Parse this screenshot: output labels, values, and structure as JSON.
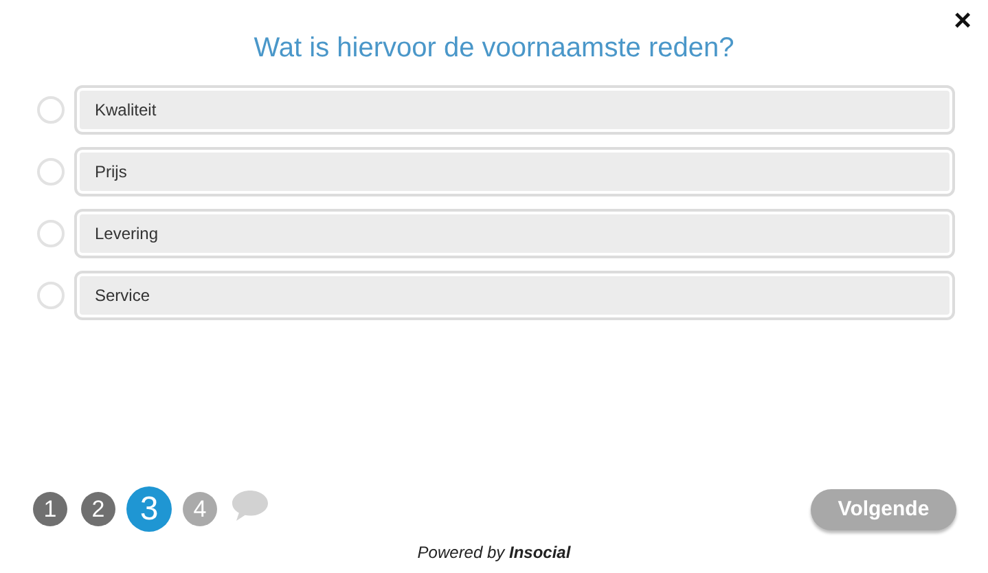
{
  "close": {
    "label": "×"
  },
  "question": "Wat is hiervoor de voornaamste reden?",
  "options": [
    {
      "label": "Kwaliteit",
      "selected": false
    },
    {
      "label": "Prijs",
      "selected": false
    },
    {
      "label": "Levering",
      "selected": false
    },
    {
      "label": "Service",
      "selected": false
    }
  ],
  "steps": [
    {
      "kind": "number",
      "label": "1",
      "completed": true,
      "selected": false
    },
    {
      "kind": "number",
      "label": "2",
      "completed": true,
      "selected": false
    },
    {
      "kind": "number",
      "label": "3",
      "completed": false,
      "selected": true
    },
    {
      "kind": "number",
      "label": "4",
      "completed": false,
      "selected": false
    },
    {
      "kind": "comment",
      "completed": false,
      "selected": false
    }
  ],
  "next_button": {
    "label": "Volgende",
    "disabled": true
  },
  "footer": "Powered by **Insocial**"
}
